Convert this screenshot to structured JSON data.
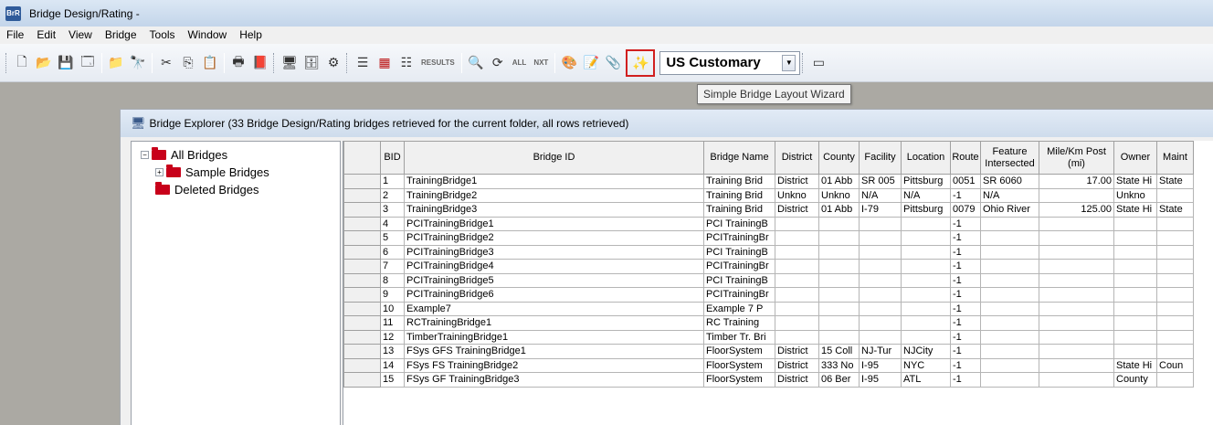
{
  "window": {
    "icon_text": "BrR",
    "title": "Bridge Design/Rating -"
  },
  "menu": [
    "File",
    "Edit",
    "View",
    "Bridge",
    "Tools",
    "Window",
    "Help"
  ],
  "toolbar": {
    "result_label": "RESULTS",
    "all_label": "ALL",
    "next_label": "NXT",
    "units_value": "US Customary",
    "units_arrow": "▼"
  },
  "tooltip": "Simple Bridge Layout Wizard",
  "explorer": {
    "title": "Bridge Explorer (33 Bridge Design/Rating bridges retrieved for the current folder, all rows retrieved)",
    "tree": [
      {
        "label": "All Bridges",
        "toggle": "−"
      },
      {
        "label": "Sample Bridges",
        "toggle": "+"
      },
      {
        "label": "Deleted Bridges",
        "toggle": ""
      }
    ],
    "columns": [
      "BID",
      "Bridge ID",
      "Bridge Name",
      "District",
      "County",
      "Facility",
      "Location",
      "Route",
      "Feature Intersected",
      "Mile/Km Post (mi)",
      "Owner",
      "Maint"
    ],
    "rows": [
      [
        "1",
        "TrainingBridge1",
        "Training Brid",
        "District",
        "01 Abb",
        "SR 005",
        "Pittsburg",
        "0051",
        "SR 6060",
        "17.00",
        "State Hi",
        "State"
      ],
      [
        "2",
        "TrainingBridge2",
        "Training Brid",
        "Unkno",
        "Unkno",
        "N/A",
        "N/A",
        "-1",
        "N/A",
        "",
        "Unkno",
        ""
      ],
      [
        "3",
        "TrainingBridge3",
        "Training Brid",
        "District",
        "01 Abb",
        "I-79",
        "Pittsburg",
        "0079",
        "Ohio River",
        "125.00",
        "State Hi",
        "State"
      ],
      [
        "4",
        "PCITrainingBridge1",
        "PCI TrainingB",
        "",
        "",
        "",
        "",
        "-1",
        "",
        "",
        "",
        ""
      ],
      [
        "5",
        "PCITrainingBridge2",
        "PCITrainingBr",
        "",
        "",
        "",
        "",
        "-1",
        "",
        "",
        "",
        ""
      ],
      [
        "6",
        "PCITrainingBridge3",
        "PCI TrainingB",
        "",
        "",
        "",
        "",
        "-1",
        "",
        "",
        "",
        ""
      ],
      [
        "7",
        "PCITrainingBridge4",
        "PCITrainingBr",
        "",
        "",
        "",
        "",
        "-1",
        "",
        "",
        "",
        ""
      ],
      [
        "8",
        "PCITrainingBridge5",
        "PCI TrainingB",
        "",
        "",
        "",
        "",
        "-1",
        "",
        "",
        "",
        ""
      ],
      [
        "9",
        "PCITrainingBridge6",
        "PCITrainingBr",
        "",
        "",
        "",
        "",
        "-1",
        "",
        "",
        "",
        ""
      ],
      [
        "10",
        "Example7",
        "Example 7 P",
        "",
        "",
        "",
        "",
        "-1",
        "",
        "",
        "",
        ""
      ],
      [
        "11",
        "RCTrainingBridge1",
        "RC Training",
        "",
        "",
        "",
        "",
        "-1",
        "",
        "",
        "",
        ""
      ],
      [
        "12",
        "TimberTrainingBridge1",
        "Timber Tr. Bri",
        "",
        "",
        "",
        "",
        "-1",
        "",
        "",
        "",
        ""
      ],
      [
        "13",
        "FSys GFS TrainingBridge1",
        "FloorSystem",
        "District",
        "15 Coll",
        "NJ-Tur",
        "NJCity",
        "-1",
        "",
        "",
        "",
        ""
      ],
      [
        "14",
        "FSys FS TrainingBridge2",
        "FloorSystem",
        "District",
        "333 No",
        "I-95",
        "NYC",
        "-1",
        "",
        "",
        "State Hi",
        "Coun"
      ],
      [
        "15",
        "FSys GF TrainingBridge3",
        "FloorSystem",
        "District",
        "06 Ber",
        "I-95",
        "ATL",
        "-1",
        "",
        "",
        "County",
        ""
      ]
    ]
  }
}
